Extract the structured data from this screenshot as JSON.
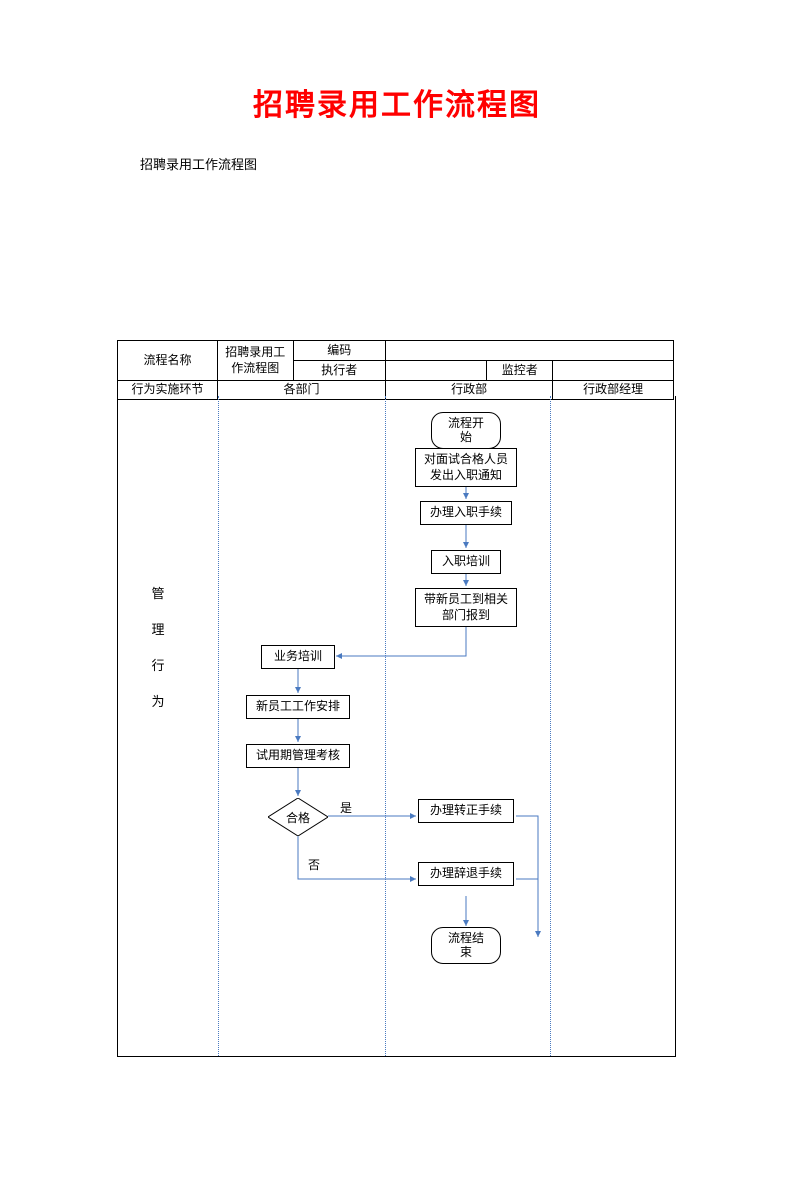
{
  "title": "招聘录用工作流程图",
  "subtitle": "招聘录用工作流程图",
  "table": {
    "r1c1": "流程名称",
    "r1c2": "招聘录用工作流程图",
    "r1c3": "编码",
    "r1c4": "",
    "r2c3": "执行者",
    "r2c4": "",
    "r2c5": "监控者",
    "r2c6": "",
    "r3c1": "行为实施环节",
    "r3c2": "各部门",
    "r3c3": "行政部",
    "r3c4": "行政部经理"
  },
  "side_label": [
    "管",
    "理",
    "行",
    "为"
  ],
  "nodes": {
    "start": "流程开始",
    "n1": "对面试合格人员发出入职通知",
    "n2": "办理入职手续",
    "n3": "入职培训",
    "n4": "带新员工到相关部门报到",
    "n5": "业务培训",
    "n6": "新员工工作安排",
    "n7": "试用期管理考核",
    "decision": "合格",
    "yes": "是",
    "no": "否",
    "n8": "办理转正手续",
    "n9": "办理辞退手续",
    "end": "流程结束"
  }
}
